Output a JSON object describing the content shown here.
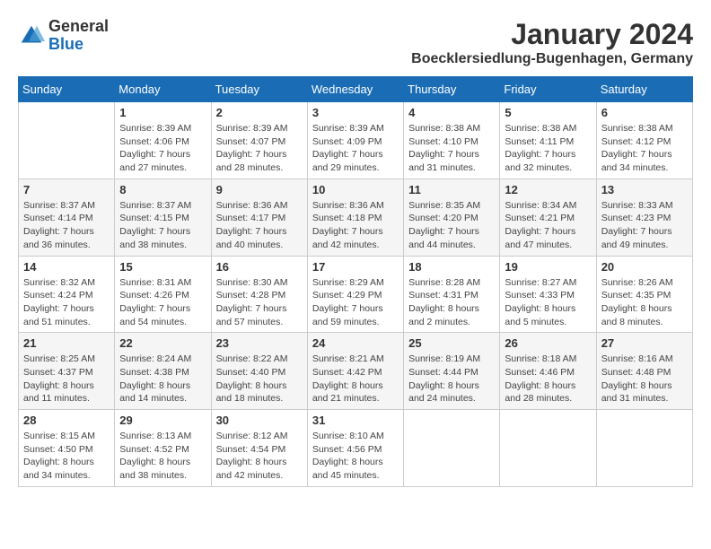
{
  "logo": {
    "general": "General",
    "blue": "Blue"
  },
  "title": "January 2024",
  "location": "Boecklersiedlung-Bugenhagen, Germany",
  "headers": [
    "Sunday",
    "Monday",
    "Tuesday",
    "Wednesday",
    "Thursday",
    "Friday",
    "Saturday"
  ],
  "weeks": [
    [
      {
        "day": "",
        "info": ""
      },
      {
        "day": "1",
        "info": "Sunrise: 8:39 AM\nSunset: 4:06 PM\nDaylight: 7 hours\nand 27 minutes."
      },
      {
        "day": "2",
        "info": "Sunrise: 8:39 AM\nSunset: 4:07 PM\nDaylight: 7 hours\nand 28 minutes."
      },
      {
        "day": "3",
        "info": "Sunrise: 8:39 AM\nSunset: 4:09 PM\nDaylight: 7 hours\nand 29 minutes."
      },
      {
        "day": "4",
        "info": "Sunrise: 8:38 AM\nSunset: 4:10 PM\nDaylight: 7 hours\nand 31 minutes."
      },
      {
        "day": "5",
        "info": "Sunrise: 8:38 AM\nSunset: 4:11 PM\nDaylight: 7 hours\nand 32 minutes."
      },
      {
        "day": "6",
        "info": "Sunrise: 8:38 AM\nSunset: 4:12 PM\nDaylight: 7 hours\nand 34 minutes."
      }
    ],
    [
      {
        "day": "7",
        "info": "Sunrise: 8:37 AM\nSunset: 4:14 PM\nDaylight: 7 hours\nand 36 minutes."
      },
      {
        "day": "8",
        "info": "Sunrise: 8:37 AM\nSunset: 4:15 PM\nDaylight: 7 hours\nand 38 minutes."
      },
      {
        "day": "9",
        "info": "Sunrise: 8:36 AM\nSunset: 4:17 PM\nDaylight: 7 hours\nand 40 minutes."
      },
      {
        "day": "10",
        "info": "Sunrise: 8:36 AM\nSunset: 4:18 PM\nDaylight: 7 hours\nand 42 minutes."
      },
      {
        "day": "11",
        "info": "Sunrise: 8:35 AM\nSunset: 4:20 PM\nDaylight: 7 hours\nand 44 minutes."
      },
      {
        "day": "12",
        "info": "Sunrise: 8:34 AM\nSunset: 4:21 PM\nDaylight: 7 hours\nand 47 minutes."
      },
      {
        "day": "13",
        "info": "Sunrise: 8:33 AM\nSunset: 4:23 PM\nDaylight: 7 hours\nand 49 minutes."
      }
    ],
    [
      {
        "day": "14",
        "info": "Sunrise: 8:32 AM\nSunset: 4:24 PM\nDaylight: 7 hours\nand 51 minutes."
      },
      {
        "day": "15",
        "info": "Sunrise: 8:31 AM\nSunset: 4:26 PM\nDaylight: 7 hours\nand 54 minutes."
      },
      {
        "day": "16",
        "info": "Sunrise: 8:30 AM\nSunset: 4:28 PM\nDaylight: 7 hours\nand 57 minutes."
      },
      {
        "day": "17",
        "info": "Sunrise: 8:29 AM\nSunset: 4:29 PM\nDaylight: 7 hours\nand 59 minutes."
      },
      {
        "day": "18",
        "info": "Sunrise: 8:28 AM\nSunset: 4:31 PM\nDaylight: 8 hours\nand 2 minutes."
      },
      {
        "day": "19",
        "info": "Sunrise: 8:27 AM\nSunset: 4:33 PM\nDaylight: 8 hours\nand 5 minutes."
      },
      {
        "day": "20",
        "info": "Sunrise: 8:26 AM\nSunset: 4:35 PM\nDaylight: 8 hours\nand 8 minutes."
      }
    ],
    [
      {
        "day": "21",
        "info": "Sunrise: 8:25 AM\nSunset: 4:37 PM\nDaylight: 8 hours\nand 11 minutes."
      },
      {
        "day": "22",
        "info": "Sunrise: 8:24 AM\nSunset: 4:38 PM\nDaylight: 8 hours\nand 14 minutes."
      },
      {
        "day": "23",
        "info": "Sunrise: 8:22 AM\nSunset: 4:40 PM\nDaylight: 8 hours\nand 18 minutes."
      },
      {
        "day": "24",
        "info": "Sunrise: 8:21 AM\nSunset: 4:42 PM\nDaylight: 8 hours\nand 21 minutes."
      },
      {
        "day": "25",
        "info": "Sunrise: 8:19 AM\nSunset: 4:44 PM\nDaylight: 8 hours\nand 24 minutes."
      },
      {
        "day": "26",
        "info": "Sunrise: 8:18 AM\nSunset: 4:46 PM\nDaylight: 8 hours\nand 28 minutes."
      },
      {
        "day": "27",
        "info": "Sunrise: 8:16 AM\nSunset: 4:48 PM\nDaylight: 8 hours\nand 31 minutes."
      }
    ],
    [
      {
        "day": "28",
        "info": "Sunrise: 8:15 AM\nSunset: 4:50 PM\nDaylight: 8 hours\nand 34 minutes."
      },
      {
        "day": "29",
        "info": "Sunrise: 8:13 AM\nSunset: 4:52 PM\nDaylight: 8 hours\nand 38 minutes."
      },
      {
        "day": "30",
        "info": "Sunrise: 8:12 AM\nSunset: 4:54 PM\nDaylight: 8 hours\nand 42 minutes."
      },
      {
        "day": "31",
        "info": "Sunrise: 8:10 AM\nSunset: 4:56 PM\nDaylight: 8 hours\nand 45 minutes."
      },
      {
        "day": "",
        "info": ""
      },
      {
        "day": "",
        "info": ""
      },
      {
        "day": "",
        "info": ""
      }
    ]
  ]
}
